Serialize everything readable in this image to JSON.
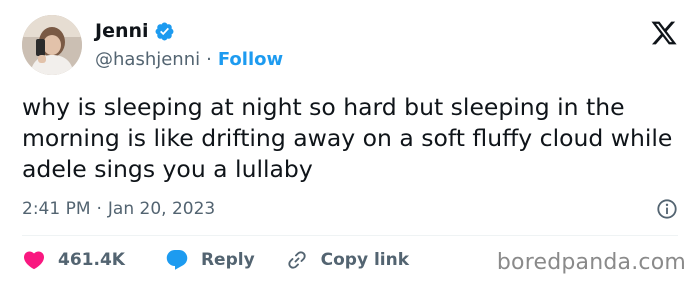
{
  "author": {
    "display_name": "Jenni",
    "handle": "@hashjenni",
    "separator": "·",
    "follow_label": "Follow",
    "verified_icon": "verified-badge-icon",
    "avatar": "profile-photo"
  },
  "brand": {
    "logo": "x-logo-icon"
  },
  "tweet": {
    "text": "why is sleeping at night so hard but sleeping in the morning is like drifting away on a soft fluffy cloud while adele sings you a lullaby",
    "time": "2:41 PM",
    "separator": "·",
    "date": "Jan 20, 2023",
    "info_icon": "info-icon"
  },
  "actions": {
    "like_count": "461.4K",
    "like_icon": "heart-icon",
    "reply_label": "Reply",
    "reply_icon": "speech-bubble-icon",
    "copy_label": "Copy link",
    "copy_icon": "link-icon"
  },
  "watermark": {
    "text": "boredpanda.com"
  },
  "colors": {
    "accent": "#1d9bf0",
    "like": "#f91880",
    "muted": "#536471",
    "text": "#0f1419"
  }
}
